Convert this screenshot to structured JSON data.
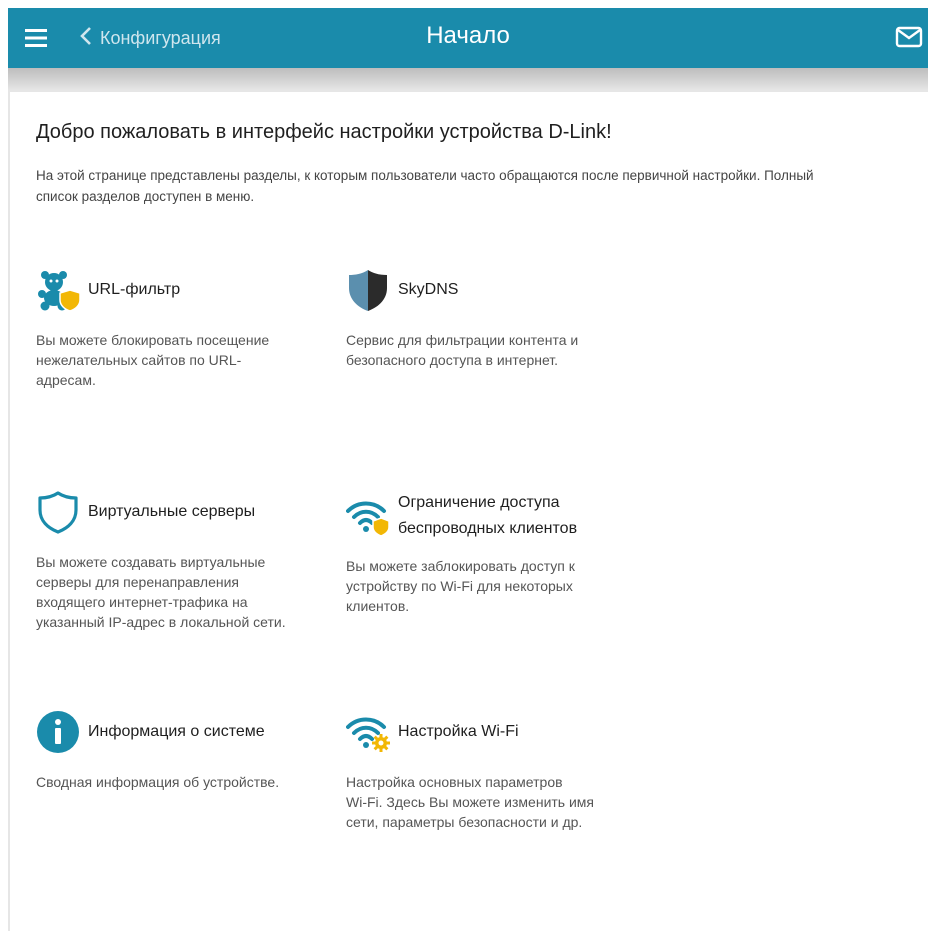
{
  "header": {
    "back_label": "Конфигурация",
    "title": "Начало"
  },
  "main": {
    "welcome": "Добро пожаловать в интерфейс настройки устройства D-Link!",
    "intro_line1": "На этой странице представлены разделы, к которым пользователи часто обращаются после первичной настройки. Полный",
    "intro_line2": "список разделов доступен в меню."
  },
  "tiles": {
    "url_filter": {
      "title": "URL-фильтр",
      "desc1": "Вы можете блокировать посещение",
      "desc2": "нежелательных сайтов по URL-",
      "desc3": "адресам."
    },
    "skydns": {
      "title": "SkyDNS",
      "desc1": "Сервис для фильтрации контента и",
      "desc2": "безопасного доступа в интернет."
    },
    "virtual_servers": {
      "title": "Виртуальные серверы",
      "desc1": "Вы можете создавать виртуальные",
      "desc2": "серверы для перенаправления",
      "desc3": "входящего интернет-трафика на",
      "desc4": "указанный IP-адрес в локальной сети."
    },
    "wireless_access": {
      "title1": "Ограничение доступа",
      "title2": "беспроводных клиентов",
      "desc1": "Вы можете заблокировать доступ к",
      "desc2": "устройству по Wi-Fi для некоторых",
      "desc3": "клиентов."
    },
    "system_info": {
      "title": "Информация о системе",
      "desc1": "Сводная информация об устройстве."
    },
    "wifi_setup": {
      "title": "Настройка Wi-Fi",
      "desc1": "Настройка основных параметров",
      "desc2": "Wi-Fi. Здесь Вы можете изменить имя",
      "desc3": "сети, параметры безопасности и др."
    }
  },
  "icons": {
    "menu": "hamburger-icon",
    "back": "chevron-left-icon",
    "mail": "mail-icon",
    "url_filter": "teddy-bear-shield-icon",
    "skydns": "shield-dark-icon",
    "virtual_servers": "shield-outline-icon",
    "wireless_access": "wifi-shield-icon",
    "system_info": "info-icon",
    "wifi_setup": "wifi-gear-icon"
  },
  "colors": {
    "accent": "#1a8bab",
    "icon_blue": "#1a8bab",
    "icon_yellow": "#f2b705",
    "icon_dark": "#2b2b2b"
  }
}
